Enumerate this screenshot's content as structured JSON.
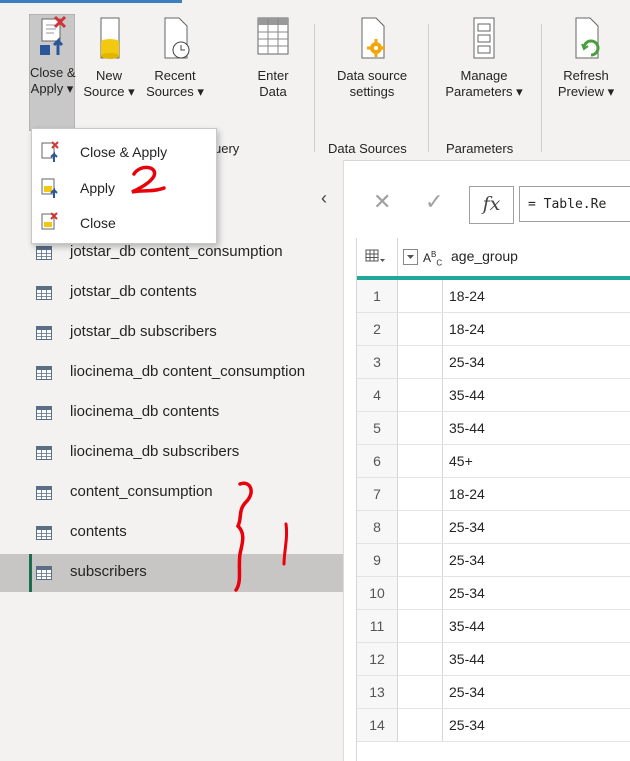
{
  "ribbon": {
    "buttons": {
      "close_apply": "Close &\nApply ▾",
      "new_source": "New\nSource ▾",
      "recent_sources": "Recent\nSources ▾",
      "enter_data": "Enter\nData",
      "data_source_settings": "Data source\nsettings",
      "manage_parameters": "Manage\nParameters ▾",
      "refresh_preview": "Refresh\nPreview ▾"
    },
    "group_labels": {
      "new_query": "uery",
      "data_sources": "Data Sources",
      "parameters": "Parameters"
    }
  },
  "close_apply_menu": {
    "items": [
      "Close & Apply",
      "Apply",
      "Close"
    ]
  },
  "queries": {
    "collapse_glyph": "‹",
    "items": [
      {
        "label": "jotstar_db content_consumption"
      },
      {
        "label": "jotstar_db contents"
      },
      {
        "label": "jotstar_db subscribers"
      },
      {
        "label": "liocinema_db content_consumption"
      },
      {
        "label": "liocinema_db contents"
      },
      {
        "label": "liocinema_db subscribers"
      },
      {
        "label": "content_consumption"
      },
      {
        "label": "contents"
      },
      {
        "label": "subscribers",
        "selected": true
      }
    ]
  },
  "formula_bar": {
    "cancel": "✕",
    "commit": "✓",
    "fx": "fx",
    "formula": "= Table.Re"
  },
  "grid": {
    "column_type": "ABC",
    "column_name": "age_group",
    "rows": [
      {
        "n": "1",
        "v": "18-24"
      },
      {
        "n": "2",
        "v": "18-24"
      },
      {
        "n": "3",
        "v": "25-34"
      },
      {
        "n": "4",
        "v": "35-44"
      },
      {
        "n": "5",
        "v": "35-44"
      },
      {
        "n": "6",
        "v": "45+"
      },
      {
        "n": "7",
        "v": "18-24"
      },
      {
        "n": "8",
        "v": "25-34"
      },
      {
        "n": "9",
        "v": "25-34"
      },
      {
        "n": "10",
        "v": "25-34"
      },
      {
        "n": "11",
        "v": "35-44"
      },
      {
        "n": "12",
        "v": "35-44"
      },
      {
        "n": "13",
        "v": "25-34"
      },
      {
        "n": "14",
        "v": "25-34"
      }
    ]
  },
  "annotations": {
    "mark_2": "2",
    "mark_1": "}1",
    "color": "#e8000b"
  },
  "colors": {
    "selected_indicator": "#1e6b52",
    "column_header_accent": "#23a79a",
    "ribbon_bg": "#f3f2f1"
  }
}
